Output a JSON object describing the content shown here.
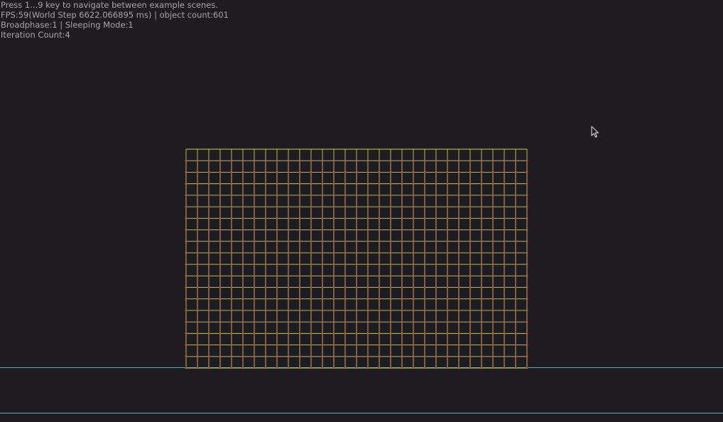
{
  "hud": {
    "instructions": "Press 1...9 key to navigate between example scenes.",
    "stats": "FPS:59(World Step 6622.066895 ms) | object count:601",
    "modes": "Broadphase:1 | Sleeping Mode:1",
    "iterations": "Iteration Count:4"
  },
  "scene": {
    "background_color": "#1f1b21",
    "ground_line_color": "#3fb8c6",
    "cloth_grid": {
      "columns": 30,
      "rows": 19,
      "constraint_color": "#b9d65a",
      "cross_constraint_color": "#e0a03c",
      "particle_color": "#e8413a"
    }
  },
  "cursor": {
    "icon": "mouse-pointer-icon"
  }
}
